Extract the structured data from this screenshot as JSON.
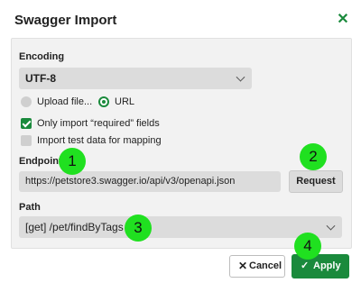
{
  "dialog": {
    "title": "Swagger Import",
    "close_icon": "close-icon"
  },
  "encoding": {
    "label": "Encoding",
    "selected": "UTF-8"
  },
  "source_options": [
    {
      "label": "Upload file...",
      "selected": false
    },
    {
      "label": "URL",
      "selected": true
    }
  ],
  "checkboxes": [
    {
      "label": "Only import “required” fields",
      "checked": true
    },
    {
      "label": "Import test data for mapping",
      "checked": false
    }
  ],
  "endpoint": {
    "label": "Endpoint",
    "value": "https://petstore3.swagger.io/api/v3/openapi.json",
    "request_label": "Request"
  },
  "path": {
    "label": "Path",
    "selected": "[get] /pet/findByTags"
  },
  "footer": {
    "cancel_label": "Cancel",
    "apply_label": "Apply"
  },
  "annotations": [
    "1",
    "2",
    "3",
    "4"
  ],
  "colors": {
    "accent": "#1a8a3c",
    "badge": "#20e020",
    "field_bg": "#dcdcdc"
  }
}
